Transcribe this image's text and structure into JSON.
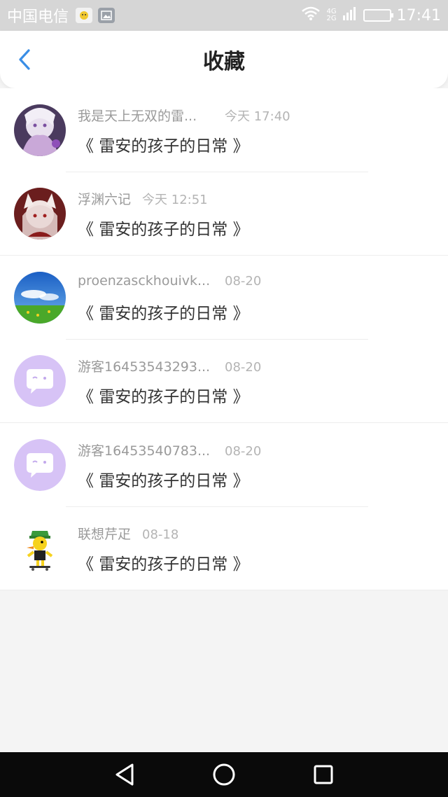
{
  "status_bar": {
    "carrier": "中国电信",
    "network_top": "4G",
    "network_bottom": "2G",
    "time": "17:41"
  },
  "header": {
    "title": "收藏"
  },
  "favorites": [
    {
      "name": "我是天上无双的雷...",
      "time": "今天 17:40",
      "title": "《 雷安的孩子的日常 》",
      "avatar": "anime-avatar-1"
    },
    {
      "name": "浮渊六记",
      "time": "今天 12:51",
      "title": "《 雷安的孩子的日常 》",
      "avatar": "anime-avatar-2"
    },
    {
      "name": "proenzasckhouivk...",
      "time": "08-20",
      "title": "《 雷安的孩子的日常 》",
      "avatar": "landscape-avatar"
    },
    {
      "name": "游客16453543293...",
      "time": "08-20",
      "title": "《 雷安的孩子的日常 》",
      "avatar": "guest-chat-avatar"
    },
    {
      "name": "游客16453540783...",
      "time": "08-20",
      "title": "《 雷安的孩子的日常 》",
      "avatar": "guest-chat-avatar"
    },
    {
      "name": "联想芹疋",
      "time": "08-18",
      "title": "《 雷安的孩子的日常 》",
      "avatar": "duck-avatar"
    }
  ],
  "colors": {
    "accent": "#3a8ee6",
    "guest_avatar": "#d7c3f6"
  }
}
